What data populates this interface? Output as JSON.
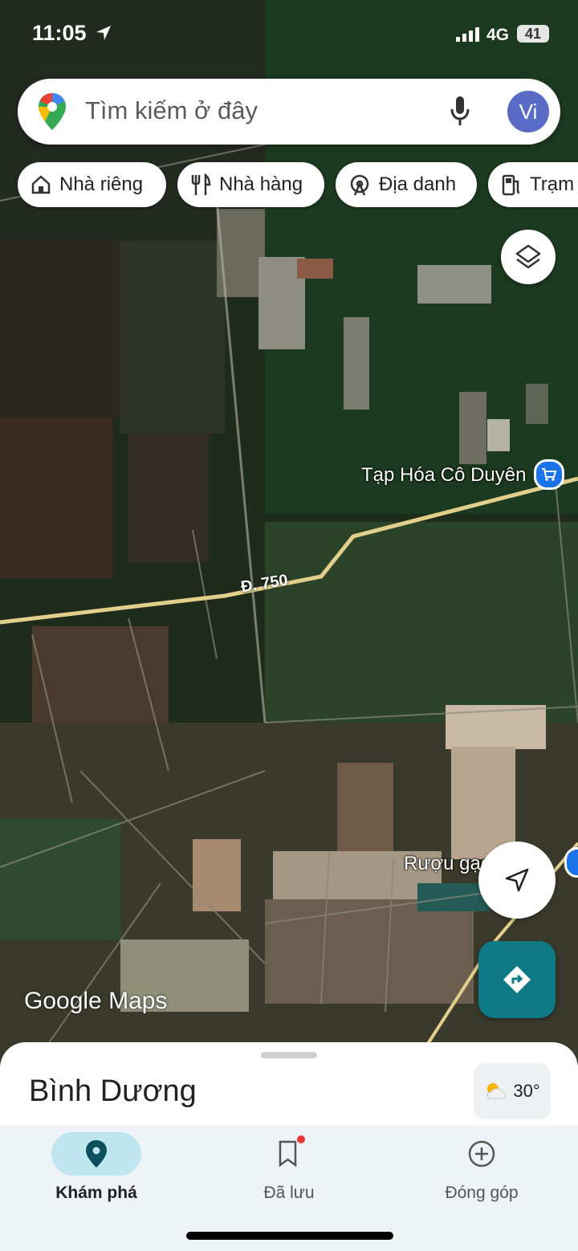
{
  "status_bar": {
    "time": "11:05",
    "network": "4G",
    "battery": "41"
  },
  "search": {
    "placeholder": "Tìm kiếm ở đây",
    "avatar_initials": "Vi"
  },
  "chips": [
    {
      "label": "Nhà riêng",
      "icon": "home-icon"
    },
    {
      "label": "Nhà hàng",
      "icon": "restaurant-icon"
    },
    {
      "label": "Địa danh",
      "icon": "landmark-icon"
    },
    {
      "label": "Trạm",
      "icon": "gas-station-icon"
    }
  ],
  "map": {
    "road_label": "Đ. 750",
    "pois": [
      {
        "name": "Tạp Hóa Cô Duyên",
        "icon": "shopping-cart-icon"
      },
      {
        "name": "Rượu gạo",
        "icon": "poi-icon"
      }
    ],
    "brand": "Google Maps"
  },
  "sheet": {
    "place_name": "Bình Dương",
    "temperature": "30°",
    "weather_icon": "partly-cloudy-icon"
  },
  "bottom_nav": [
    {
      "label": "Khám phá",
      "icon": "explore-pin-icon",
      "active": true
    },
    {
      "label": "Đã lưu",
      "icon": "saved-bookmark-icon",
      "active": false
    },
    {
      "label": "Đóng góp",
      "icon": "contribute-plus-icon",
      "active": false
    }
  ],
  "colors": {
    "accent": "#0e7a86",
    "nav_active": "#bfe6f0",
    "avatar": "#5a6bc5",
    "poi_blue": "#1a73e8"
  }
}
